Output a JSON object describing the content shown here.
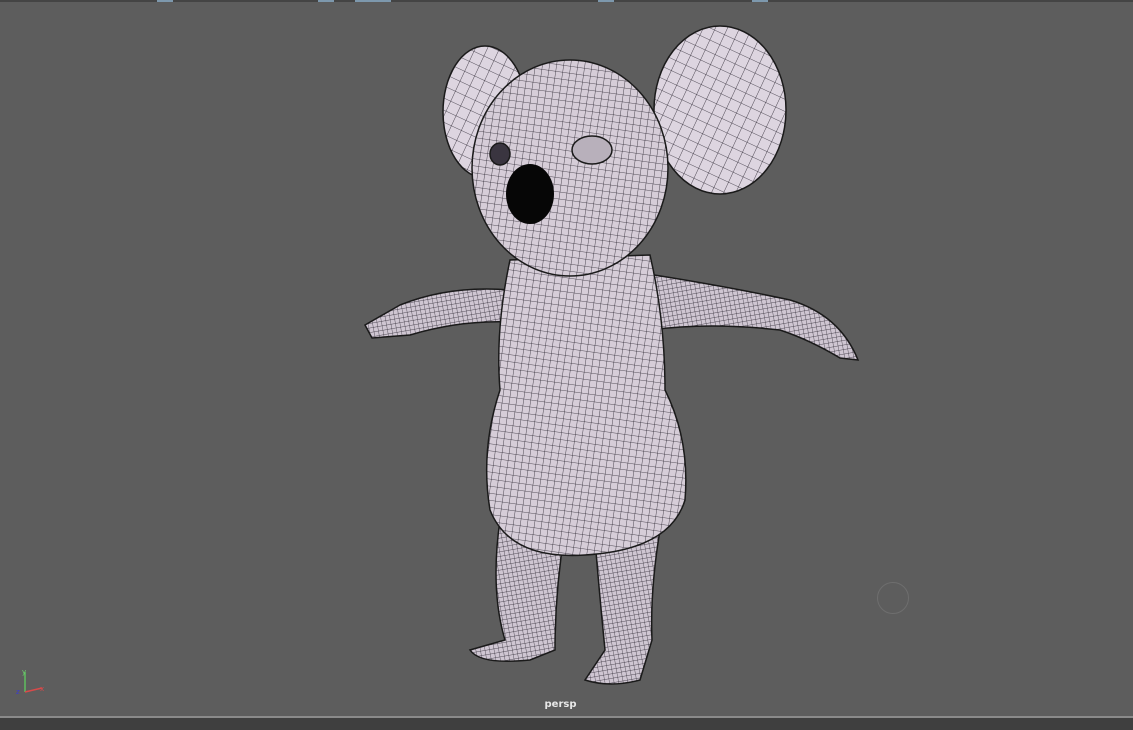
{
  "viewport": {
    "camera_label": "persp",
    "background_color": "#5d5d5d",
    "mesh_color": "#d6cdd8",
    "axis": {
      "x_label": "x",
      "y_label": "y",
      "z_label": "z"
    }
  }
}
